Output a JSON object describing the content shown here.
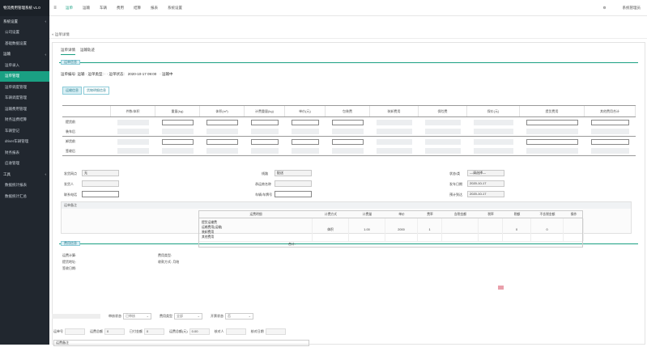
{
  "sidebar": {
    "brand": "物流费用管理系统 v1.0",
    "items": [
      {
        "label": "系统设置",
        "type": "group",
        "arrow": "‹"
      },
      {
        "label": "公司设置",
        "type": "sub"
      },
      {
        "label": "基础数据设置",
        "type": "sub"
      },
      {
        "label": "运输",
        "type": "group",
        "arrow": "‹"
      },
      {
        "label": "运单录入",
        "type": "sub"
      },
      {
        "label": "运单管理",
        "type": "sub",
        "active": true
      },
      {
        "label": "运单调度管理",
        "type": "sub"
      },
      {
        "label": "车辆调度管理",
        "type": "sub"
      },
      {
        "label": "运输费用管理",
        "type": "sub"
      },
      {
        "label": "财务运费结算",
        "type": "sub"
      },
      {
        "label": "车辆登记",
        "type": "sub"
      },
      {
        "label": "driver车辆管理",
        "type": "sub"
      },
      {
        "label": "财务报表",
        "type": "sub"
      },
      {
        "label": "应收管理",
        "type": "sub"
      },
      {
        "label": "工具",
        "type": "group",
        "arrow": "‹"
      },
      {
        "label": "数据统计报表",
        "type": "sub"
      },
      {
        "label": "数据统计汇总",
        "type": "sub"
      }
    ]
  },
  "topbar": {
    "menu_icon": "≡",
    "nav": [
      "运单",
      "运输",
      "车辆",
      "费用",
      "结算",
      "报表",
      "系统设置"
    ],
    "active_index": 0,
    "right_icon": "⚙",
    "user": "系统管理员"
  },
  "tabs_bar": {
    "label": "« 运单详情"
  },
  "subtabs": [
    "运单详情",
    "运输轨迹"
  ],
  "section1": {
    "title": "运单信息"
  },
  "info_line": {
    "left": "运单编号: 运输 · 运单类型: · · 运单状态:",
    "mid": "2020-10-17 09:00",
    "right": "· 运输中"
  },
  "seg_tabs": [
    "运输信息",
    "货物明细信息"
  ],
  "grid": {
    "headers": [
      "件数/体积",
      "重量(kg)",
      "体积(m³)",
      "计费重量(kg)",
      "单价(元)",
      "包装费",
      "装卸费用",
      "保险费",
      "保价(元)",
      "提货费用",
      "其他费用合计",
      "备注"
    ],
    "rows": [
      {
        "label": "提货前",
        "sep": false
      },
      {
        "label": "装车后",
        "sep": true
      },
      {
        "label": "卸货前",
        "sep": false
      },
      {
        "label": "签收后",
        "sep": true
      }
    ]
  },
  "form": {
    "shipper_label": "发货网点",
    "shipper_value": "无",
    "sender_label": "发货人",
    "phone_label": "联系电话",
    "route_label": "线路",
    "route_value": "配送",
    "carrier_label": "承运商名称",
    "vehicle_label": "车辆/车牌号",
    "status_label": "状态/类",
    "status_value": "—请选择—",
    "date_label": "发车日期",
    "date_value": "2020-10-17",
    "arrive_label": "预计到达",
    "arrive_value": "2020-10-17"
  },
  "remark": {
    "title": "运单备注"
  },
  "section2": {
    "title": "费用信息"
  },
  "fee_info": {
    "line1": "运费计算:",
    "line2": "提货地址:",
    "line3": "签收日期:",
    "col2_line1": "费用类型:",
    "col2_line2": "收款方式: 月结"
  },
  "fee_table": {
    "headers": [
      "运费明细",
      "计费方式",
      "计费量",
      "单价",
      "费率",
      "含税金额",
      "税率",
      "税额",
      "不含税金额",
      "操作"
    ],
    "desc_lines": [
      "提货运输费",
      "运输费用(运输)",
      "装卸费用",
      "其他费用"
    ],
    "values": [
      "体积",
      "1.00",
      "2000",
      "1",
      "",
      "",
      "0",
      "0",
      ""
    ],
    "footer": "合计:"
  },
  "bottom_filters": [
    {
      "label": "审核状态",
      "value": "已审核"
    },
    {
      "label": "费用类型",
      "value": "全部"
    },
    {
      "label": "开票状态",
      "value": "否"
    }
  ],
  "bottom_row": [
    {
      "label": "运单号",
      "value": ""
    },
    {
      "label": "运费总额",
      "value": "0"
    },
    {
      "label": "已付金额",
      "value": "0"
    },
    {
      "label": "运费总额(元)",
      "value": "0.00"
    },
    {
      "label": "核对人",
      "value": ""
    },
    {
      "label": "核对日期",
      "value": ""
    }
  ],
  "bottom_remark": {
    "label": "运费备注"
  }
}
